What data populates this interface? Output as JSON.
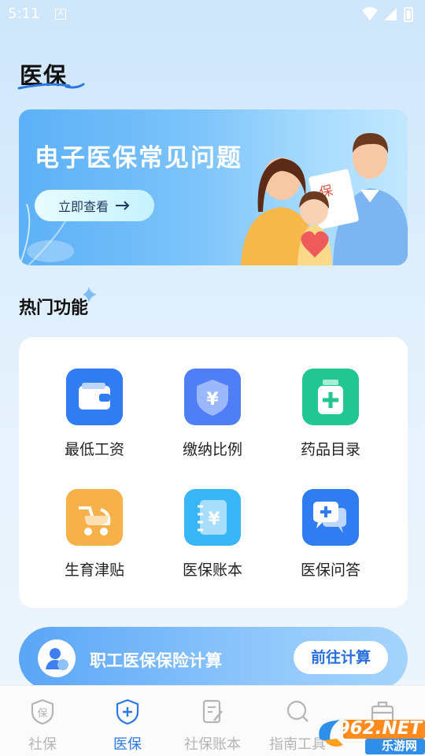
{
  "status_bar": {
    "time": "5:11",
    "notif_letter": "A"
  },
  "page": {
    "title": "医保"
  },
  "banner": {
    "title": "电子医保常见问题",
    "button_label": "立即查看",
    "badge_text": "保"
  },
  "hot_section": {
    "title": "热门功能",
    "items": [
      {
        "label": "最低工资",
        "icon": "wallet-icon",
        "color": "#2f7df0"
      },
      {
        "label": "缴纳比例",
        "icon": "yuan-shield-icon",
        "color": "#4f7ef7"
      },
      {
        "label": "药品目录",
        "icon": "medicine-bottle-icon",
        "color": "#22c690"
      },
      {
        "label": "生育津贴",
        "icon": "baby-stroller-icon",
        "color": "#f7b14b"
      },
      {
        "label": "医保账本",
        "icon": "yuan-notebook-icon",
        "color": "#39b6f5"
      },
      {
        "label": "医保问答",
        "icon": "chat-plus-icon",
        "color": "#2f7df0"
      }
    ]
  },
  "calculator": {
    "title": "职工医保保险计算",
    "button_label": "前往计算"
  },
  "tab_bar": {
    "active_index": 1,
    "active_color": "#2c7be5",
    "items": [
      {
        "label": "社保",
        "icon": "shield-bao-icon"
      },
      {
        "label": "医保",
        "icon": "shield-plus-icon"
      },
      {
        "label": "社保账本",
        "icon": "notebook-pen-icon"
      },
      {
        "label": "指南工具",
        "icon": "search-icon"
      },
      {
        "label": "",
        "icon": "briefcase-icon"
      }
    ]
  },
  "watermark": {
    "text": "962.NET",
    "sub": "乐游网"
  }
}
